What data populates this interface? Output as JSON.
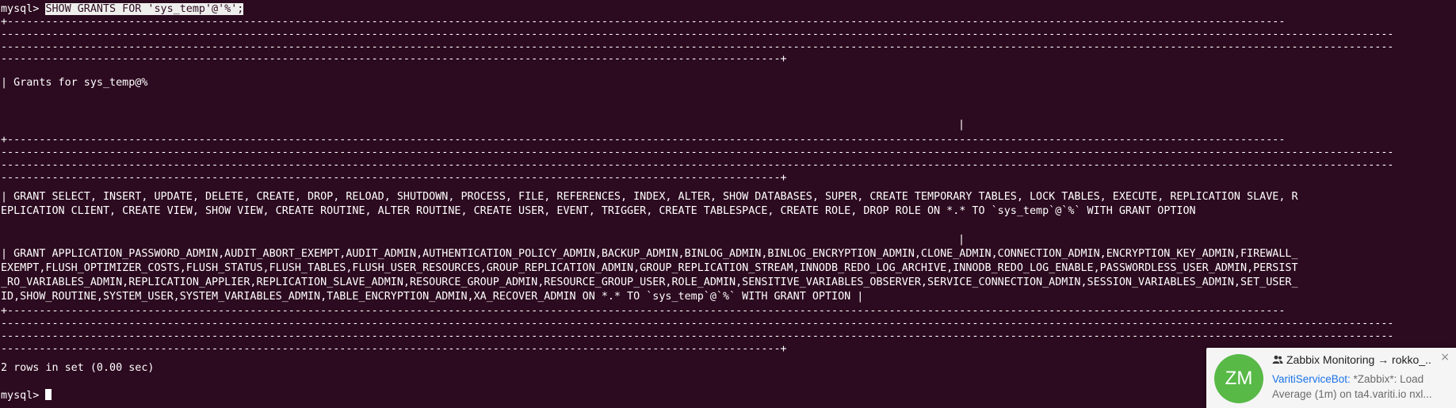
{
  "terminal": {
    "prompt": "mysql> ",
    "command": "SHOW GRANTS FOR 'sys_temp'@'%';",
    "table": {
      "border_a": "+--------------------------------------------------------------------------------------------------------------------------------------------------------------------------------------------------------",
      "border_b": "--------------------------------------------------------------------------------------------------------------------------------------------------------------------------------------------------------------------------",
      "border_c": "--------------------------------------------------------------------------------------------------------------------------+",
      "header": "| Grants for sys_temp@%",
      "pipe": "|",
      "row1_line1": "| GRANT SELECT, INSERT, UPDATE, DELETE, CREATE, DROP, RELOAD, SHUTDOWN, PROCESS, FILE, REFERENCES, INDEX, ALTER, SHOW DATABASES, SUPER, CREATE TEMPORARY TABLES, LOCK TABLES, EXECUTE, REPLICATION SLAVE, R",
      "row1_line2": "EPLICATION CLIENT, CREATE VIEW, SHOW VIEW, CREATE ROUTINE, ALTER ROUTINE, CREATE USER, EVENT, TRIGGER, CREATE TABLESPACE, CREATE ROLE, DROP ROLE ON *.* TO `sys_temp`@`%` WITH GRANT OPTION",
      "row2_line1": "| GRANT APPLICATION_PASSWORD_ADMIN,AUDIT_ABORT_EXEMPT,AUDIT_ADMIN,AUTHENTICATION_POLICY_ADMIN,BACKUP_ADMIN,BINLOG_ADMIN,BINLOG_ENCRYPTION_ADMIN,CLONE_ADMIN,CONNECTION_ADMIN,ENCRYPTION_KEY_ADMIN,FIREWALL_",
      "row2_line2": "EXEMPT,FLUSH_OPTIMIZER_COSTS,FLUSH_STATUS,FLUSH_TABLES,FLUSH_USER_RESOURCES,GROUP_REPLICATION_ADMIN,GROUP_REPLICATION_STREAM,INNODB_REDO_LOG_ARCHIVE,INNODB_REDO_LOG_ENABLE,PASSWORDLESS_USER_ADMIN,PERSIST",
      "row2_line3": "_RO_VARIABLES_ADMIN,REPLICATION_APPLIER,REPLICATION_SLAVE_ADMIN,RESOURCE_GROUP_ADMIN,RESOURCE_GROUP_USER,ROLE_ADMIN,SENSITIVE_VARIABLES_OBSERVER,SERVICE_CONNECTION_ADMIN,SESSION_VARIABLES_ADMIN,SET_USER_",
      "row2_line4": "ID,SHOW_ROUTINE,SYSTEM_USER,SYSTEM_VARIABLES_ADMIN,TABLE_ENCRYPTION_ADMIN,XA_RECOVER_ADMIN ON *.* TO `sys_temp`@`%` WITH GRANT OPTION |"
    },
    "result": "2 rows in set (0.00 sec)",
    "final_prompt": "mysql> "
  },
  "notification": {
    "avatar_initials": "ZM",
    "title": "Zabbix Monitoring → rokko_...",
    "close": "×",
    "sender": "VaritiServiceBot:",
    "message": " *Zabbix*: Load Average (1m) on ta4.variti.io nxl..."
  },
  "colors": {
    "terminal_bg": "#2c0a1f",
    "terminal_fg": "#ffffff",
    "avatar_bg": "#58b947",
    "link": "#1a73e8"
  }
}
